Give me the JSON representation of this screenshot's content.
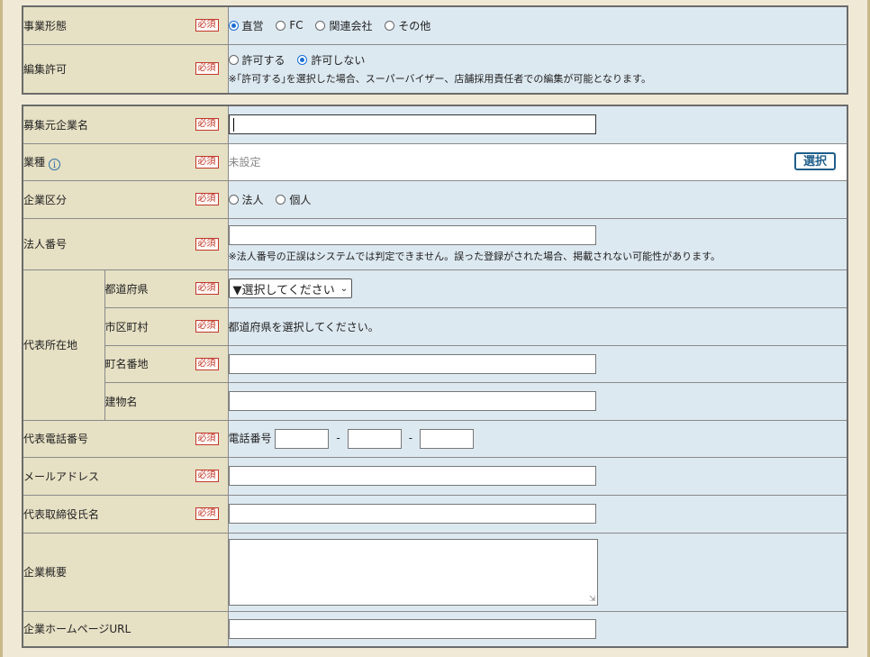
{
  "section1": {
    "business_type": {
      "label": "事業形態",
      "required": "必須",
      "options": [
        "直営",
        "FC",
        "関連会社",
        "その他"
      ],
      "selected": "直営"
    },
    "edit_permission": {
      "label": "編集許可",
      "required": "必須",
      "options": [
        "許可する",
        "許可しない"
      ],
      "selected": "許可しない",
      "note": "※｢許可する｣を選択した場合、スーパーバイザー、店舗採用責任者での編集が可能となります。"
    }
  },
  "section2": {
    "company_name": {
      "label": "募集元企業名",
      "required": "必須",
      "value": ""
    },
    "industry": {
      "label": "業種",
      "required": "必須",
      "value": "未設定",
      "button": "選択"
    },
    "company_category": {
      "label": "企業区分",
      "required": "必須",
      "options": [
        "法人",
        "個人"
      ]
    },
    "corporate_number": {
      "label": "法人番号",
      "required": "必須",
      "value": "",
      "note": "※法人番号の正誤はシステムでは判定できません。誤った登録がされた場合、掲載されない可能性があります。"
    },
    "address": {
      "label": "代表所在地",
      "prefecture": {
        "label": "都道府県",
        "required": "必須",
        "select_value": "▼選択してください"
      },
      "city": {
        "label": "市区町村",
        "required": "必須",
        "message": "都道府県を選択してください。"
      },
      "street": {
        "label": "町名番地",
        "required": "必須",
        "value": ""
      },
      "building": {
        "label": "建物名",
        "value": ""
      }
    },
    "phone": {
      "label": "代表電話番号",
      "required": "必須",
      "prefix": "電話番号",
      "separator": "-"
    },
    "email": {
      "label": "メールアドレス",
      "required": "必須",
      "value": ""
    },
    "representative": {
      "label": "代表取締役氏名",
      "required": "必須",
      "value": ""
    },
    "overview": {
      "label": "企業概要",
      "value": ""
    },
    "homepage": {
      "label": "企業ホームページURL",
      "value": ""
    }
  },
  "colors": {
    "label_bg": "#e6e0c4",
    "value_bg": "#dde9f1",
    "required": "#c0392b",
    "accent": "#1a6fd3"
  }
}
